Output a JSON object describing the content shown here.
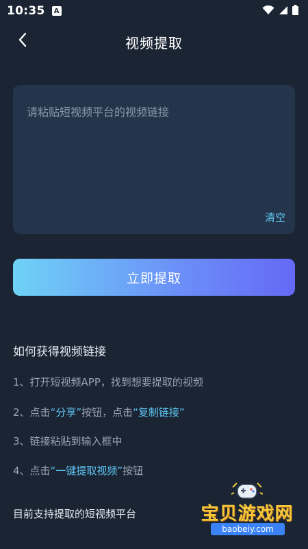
{
  "status_bar": {
    "time": "10:35",
    "notification_glyph": "A",
    "icons": [
      "wifi-icon",
      "signal-icon",
      "battery-icon"
    ]
  },
  "header": {
    "back_icon": "chevron-left-icon",
    "title": "视频提取"
  },
  "link_input": {
    "value": "",
    "placeholder": "请粘贴短视频平台的视频链接",
    "clear_label": "清空"
  },
  "extract_button": {
    "label": "立即提取"
  },
  "howto": {
    "title": "如何获得视频链接",
    "step1": "1、打开短视频APP，找到想要提取的视频",
    "step2": {
      "prefix": "2、点击",
      "highlight1": "“分享”",
      "middle": "按钮，点击",
      "highlight2": "“复制链接”"
    },
    "step3": "3、链接粘贴到输入框中",
    "step4": {
      "prefix": "4、点击",
      "highlight": "“一键提取视频”",
      "suffix": "按钮"
    }
  },
  "support": {
    "title": "目前支持提取的短视频平台"
  },
  "watermark": {
    "logo_text": "宝贝游戏网",
    "url": "baobeiy.com"
  },
  "colors": {
    "background": "#1a2433",
    "input_bg": "#24344b",
    "accent": "#5fc4f2",
    "gradient_start": "#6fd2f6",
    "gradient_end": "#6569f6"
  }
}
